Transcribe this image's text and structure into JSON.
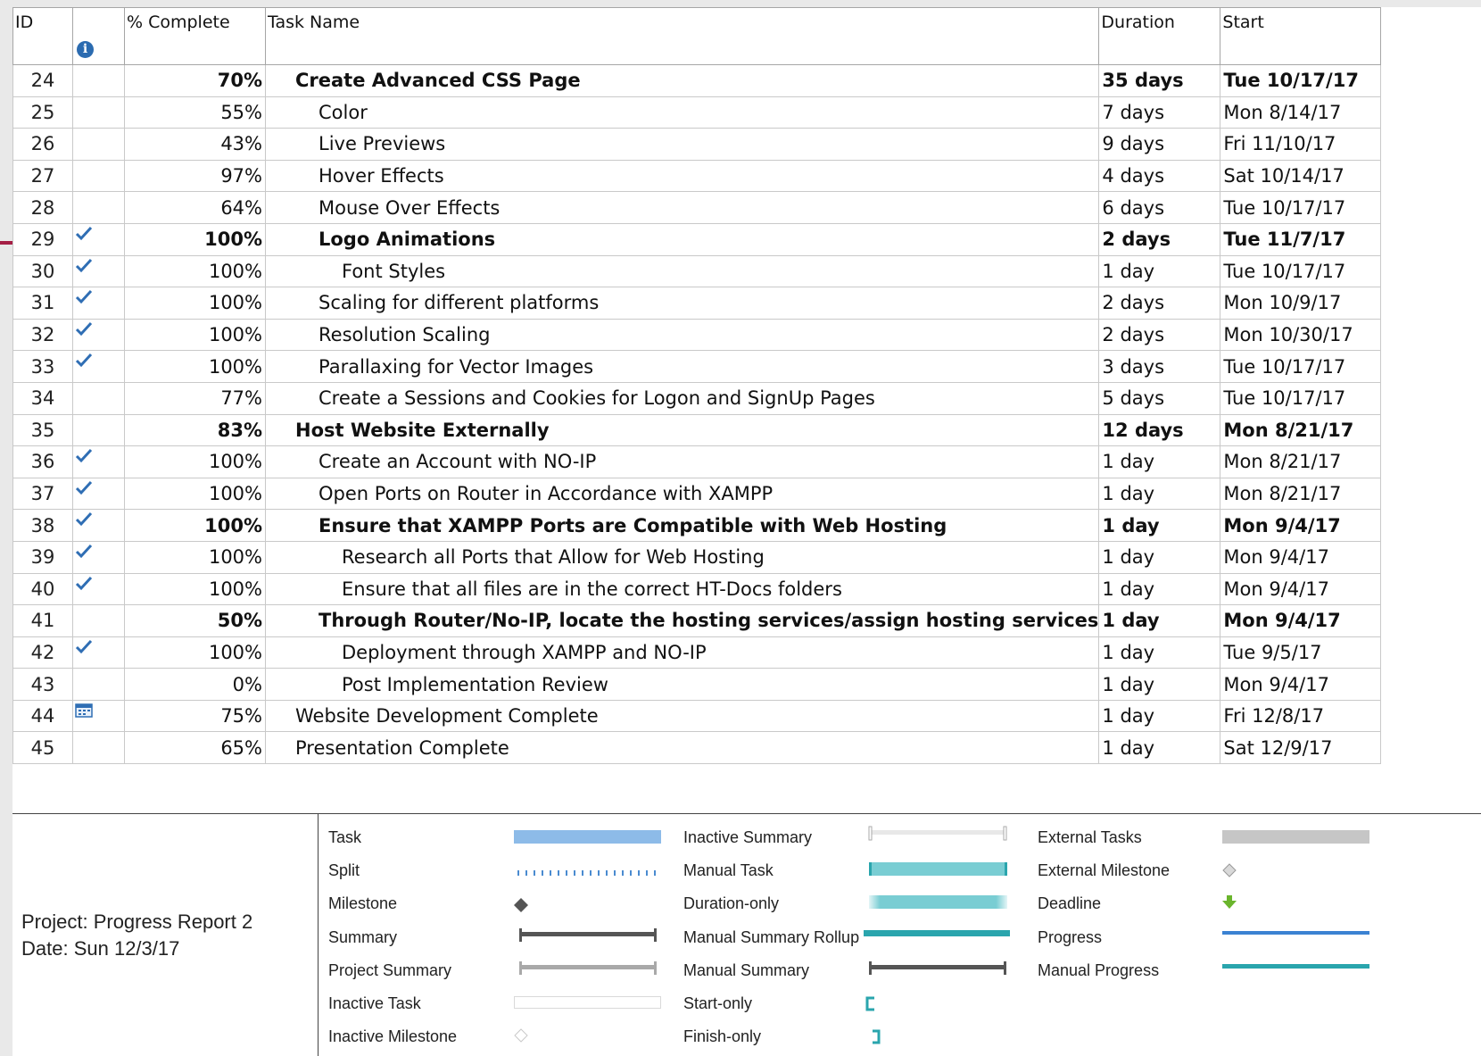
{
  "columns": {
    "id": "ID",
    "pct": "% Complete",
    "name": "Task Name",
    "duration": "Duration",
    "start": "Start",
    "indicator_icon": "info-icon"
  },
  "rows": [
    {
      "id": "24",
      "pct": "70%",
      "name": "Create Advanced CSS Page",
      "duration": "35 days",
      "start": "Tue 10/17/17",
      "bold": true,
      "level": 0,
      "indicator": ""
    },
    {
      "id": "25",
      "pct": "55%",
      "name": "Color",
      "duration": "7 days",
      "start": "Mon 8/14/17",
      "bold": false,
      "level": 1,
      "indicator": ""
    },
    {
      "id": "26",
      "pct": "43%",
      "name": "Live Previews",
      "duration": "9 days",
      "start": "Fri 11/10/17",
      "bold": false,
      "level": 1,
      "indicator": ""
    },
    {
      "id": "27",
      "pct": "97%",
      "name": "Hover Effects",
      "duration": "4 days",
      "start": "Sat 10/14/17",
      "bold": false,
      "level": 1,
      "indicator": ""
    },
    {
      "id": "28",
      "pct": "64%",
      "name": "Mouse Over Effects",
      "duration": "6 days",
      "start": "Tue 10/17/17",
      "bold": false,
      "level": 1,
      "indicator": ""
    },
    {
      "id": "29",
      "pct": "100%",
      "name": "Logo Animations",
      "duration": "2 days",
      "start": "Tue 11/7/17",
      "bold": true,
      "level": 1,
      "indicator": "check"
    },
    {
      "id": "30",
      "pct": "100%",
      "name": "Font Styles",
      "duration": "1 day",
      "start": "Tue 10/17/17",
      "bold": false,
      "level": 2,
      "indicator": "check"
    },
    {
      "id": "31",
      "pct": "100%",
      "name": "Scaling for different platforms",
      "duration": "2 days",
      "start": "Mon 10/9/17",
      "bold": false,
      "level": 1,
      "indicator": "check"
    },
    {
      "id": "32",
      "pct": "100%",
      "name": "Resolution Scaling",
      "duration": "2 days",
      "start": "Mon 10/30/17",
      "bold": false,
      "level": 1,
      "indicator": "check"
    },
    {
      "id": "33",
      "pct": "100%",
      "name": "Parallaxing for Vector Images",
      "duration": "3 days",
      "start": "Tue 10/17/17",
      "bold": false,
      "level": 1,
      "indicator": "check"
    },
    {
      "id": "34",
      "pct": "77%",
      "name": "Create a Sessions and Cookies for Logon and SignUp Pages",
      "duration": "5 days",
      "start": "Tue 10/17/17",
      "bold": false,
      "level": 1,
      "indicator": ""
    },
    {
      "id": "35",
      "pct": "83%",
      "name": "Host Website Externally",
      "duration": "12 days",
      "start": "Mon 8/21/17",
      "bold": true,
      "level": 0,
      "indicator": ""
    },
    {
      "id": "36",
      "pct": "100%",
      "name": "Create an Account with NO-IP",
      "duration": "1 day",
      "start": "Mon 8/21/17",
      "bold": false,
      "level": 1,
      "indicator": "check"
    },
    {
      "id": "37",
      "pct": "100%",
      "name": "Open Ports on Router in Accordance with XAMPP",
      "duration": "1 day",
      "start": "Mon 8/21/17",
      "bold": false,
      "level": 1,
      "indicator": "check"
    },
    {
      "id": "38",
      "pct": "100%",
      "name": "Ensure that XAMPP Ports are Compatible with Web Hosting",
      "duration": "1 day",
      "start": "Mon 9/4/17",
      "bold": true,
      "level": 1,
      "indicator": "check"
    },
    {
      "id": "39",
      "pct": "100%",
      "name": "Research all Ports that Allow for Web Hosting",
      "duration": "1 day",
      "start": "Mon 9/4/17",
      "bold": false,
      "level": 2,
      "indicator": "check"
    },
    {
      "id": "40",
      "pct": "100%",
      "name": "Ensure that all files are in the correct HT-Docs folders",
      "duration": "1 day",
      "start": "Mon 9/4/17",
      "bold": false,
      "level": 2,
      "indicator": "check"
    },
    {
      "id": "41",
      "pct": "50%",
      "name": "Through Router/No-IP, locate the hosting services/assign hosting services",
      "duration": "1 day",
      "start": "Mon 9/4/17",
      "bold": true,
      "level": 1,
      "indicator": ""
    },
    {
      "id": "42",
      "pct": "100%",
      "name": "Deployment through XAMPP and NO-IP",
      "duration": "1 day",
      "start": "Tue 9/5/17",
      "bold": false,
      "level": 2,
      "indicator": "check"
    },
    {
      "id": "43",
      "pct": "0%",
      "name": "Post Implementation Review",
      "duration": "1 day",
      "start": "Mon 9/4/17",
      "bold": false,
      "level": 2,
      "indicator": ""
    },
    {
      "id": "44",
      "pct": "75%",
      "name": "Website Development Complete",
      "duration": "1 day",
      "start": "Fri 12/8/17",
      "bold": false,
      "level": 0,
      "indicator": "calendar"
    },
    {
      "id": "45",
      "pct": "65%",
      "name": "Presentation Complete",
      "duration": "1 day",
      "start": "Sat 12/9/17",
      "bold": false,
      "level": 0,
      "indicator": ""
    }
  ],
  "project_info": {
    "project": "Project: Progress Report 2",
    "date": "Date: Sun 12/3/17"
  },
  "legend": {
    "col1": [
      "Task",
      "Split",
      "Milestone",
      "Summary",
      "Project Summary",
      "Inactive Task",
      "Inactive Milestone"
    ],
    "col2": [
      "Inactive Summary",
      "Manual Task",
      "Duration-only",
      "Manual Summary Rollup",
      "Manual Summary",
      "Start-only",
      "Finish-only"
    ],
    "col3": [
      "External Tasks",
      "External Milestone",
      "Deadline",
      "Progress",
      "Manual Progress"
    ]
  },
  "colors": {
    "task_bar": "#8dbbe8",
    "split": "#4a8bd0",
    "milestone": "#555555",
    "summary": "#555555",
    "project_summary": "#a9a9a9",
    "manual_task": "#79cdd3",
    "manual_summary_rollup": "#2aa5ad",
    "external_task": "#c6c6c6",
    "deadline": "#6ab52c",
    "progress": "#3b82d2",
    "manual_progress": "#2aa5ad",
    "check": "#2f6eb4"
  }
}
